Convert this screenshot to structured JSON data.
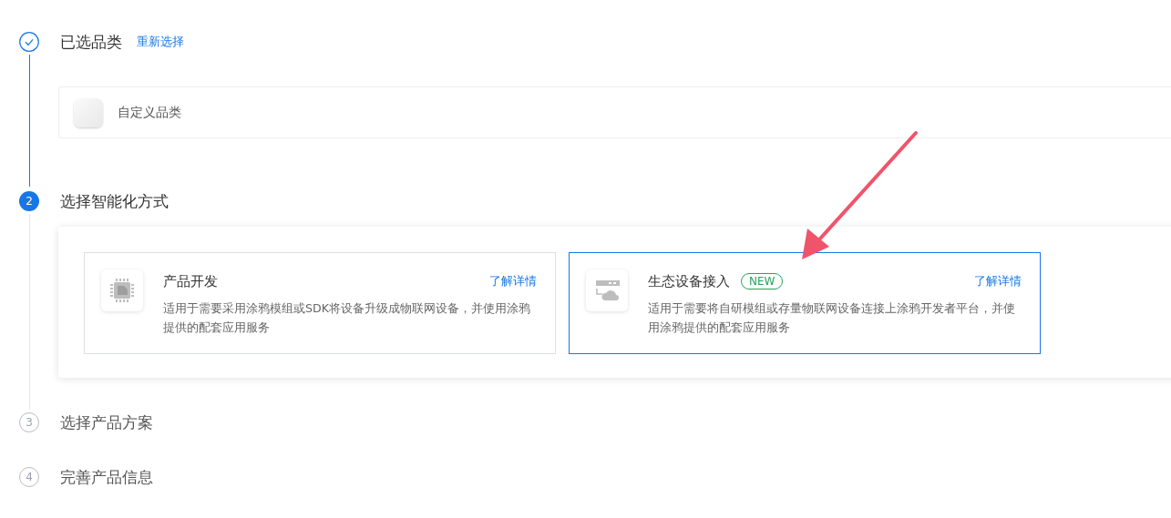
{
  "steps": [
    {
      "done": true,
      "active": false,
      "title": "已选品类",
      "link": "重新选择",
      "category": {
        "name": "自定义品类"
      }
    },
    {
      "number": "2",
      "done": false,
      "active": true,
      "title": "选择智能化方式",
      "options": [
        {
          "kind": "chip",
          "title": "产品开发",
          "selected": false,
          "details_link": "了解详情",
          "description": "适用于需要采用涂鸦模组或SDK将设备升级成物联网设备，并使用涂鸦提供的配套应用服务"
        },
        {
          "kind": "cloud",
          "title": "生态设备接入",
          "badge": "NEW",
          "selected": true,
          "details_link": "了解详情",
          "description": "适用于需要将自研模组或存量物联网设备连接上涂鸦开发者平台，并使用涂鸦提供的配套应用服务"
        }
      ]
    },
    {
      "number": "3",
      "done": false,
      "active": false,
      "title": "选择产品方案"
    },
    {
      "number": "4",
      "done": false,
      "active": false,
      "title": "完善产品信息"
    }
  ]
}
